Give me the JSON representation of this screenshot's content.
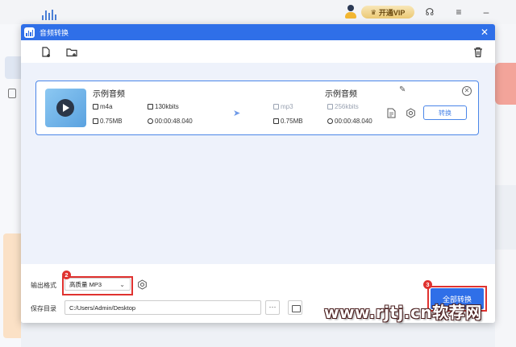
{
  "background_app": {
    "vip_label": "开通VIP"
  },
  "dialog": {
    "title": "音频转换"
  },
  "file_item": {
    "source_name": "示例音频",
    "source_format": "m4a",
    "source_bitrate": "130kbits",
    "source_size": "0.75MB",
    "source_duration": "00:00:48.040",
    "target_name": "示例音频",
    "target_format": "mp3",
    "target_bitrate": "256kbits",
    "target_size": "0.75MB",
    "target_duration": "00:00:48.040",
    "convert_label": "转换"
  },
  "bottom": {
    "format_label": "输出格式",
    "format_value": "高质量 MP3",
    "save_label": "保存目录",
    "save_path": "C:/Users/Admin/Desktop",
    "dots_label": "···",
    "convert_all_label": "全部转换"
  },
  "annotations": {
    "badge_2": "2",
    "badge_3": "3",
    "highlight_color": "#e0322f"
  },
  "watermark": "www.rjtj.cn软荐网",
  "colors": {
    "accent": "#2f6fe8"
  }
}
